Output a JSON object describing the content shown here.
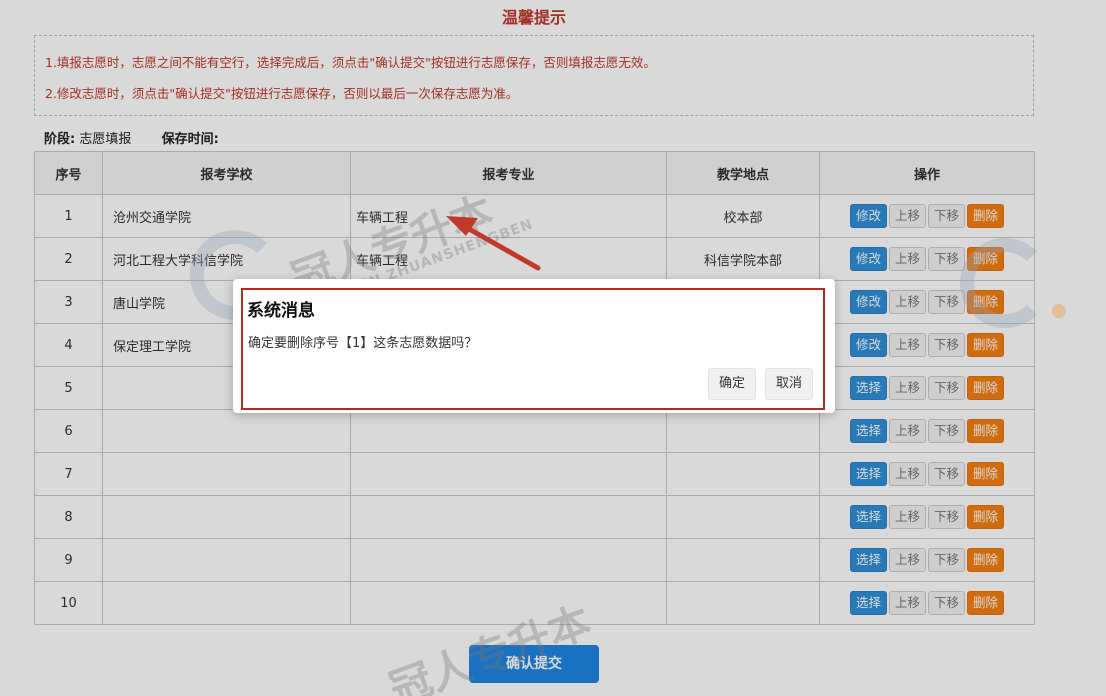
{
  "notice": {
    "title": "温馨提示",
    "line1": "1.填报志愿时，志愿之间不能有空行，选择完成后，须点击\"确认提交\"按钮进行志愿保存，否则填报志愿无效。",
    "line2": "2.修改志愿时，须点击\"确认提交\"按钮进行志愿保存，否则以最后一次保存志愿为准。"
  },
  "stage": {
    "label": "阶段:",
    "value": "志愿填报",
    "save_label": "保存时间:"
  },
  "table": {
    "headers": [
      "序号",
      "报考学校",
      "报考专业",
      "教学地点",
      "操作"
    ],
    "rows": [
      {
        "idx": "1",
        "school": "沧州交通学院",
        "major": "车辆工程",
        "location": "校本部",
        "action": "修改"
      },
      {
        "idx": "2",
        "school": "河北工程大学科信学院",
        "major": "车辆工程",
        "location": "科信学院本部",
        "action": "修改"
      },
      {
        "idx": "3",
        "school": "唐山学院",
        "major": "",
        "location": "",
        "action": "修改"
      },
      {
        "idx": "4",
        "school": "保定理工学院",
        "major": "",
        "location": "",
        "action": "修改"
      },
      {
        "idx": "5",
        "school": "",
        "major": "",
        "location": "",
        "action": "选择"
      },
      {
        "idx": "6",
        "school": "",
        "major": "",
        "location": "",
        "action": "选择"
      },
      {
        "idx": "7",
        "school": "",
        "major": "",
        "location": "",
        "action": "选择"
      },
      {
        "idx": "8",
        "school": "",
        "major": "",
        "location": "",
        "action": "选择"
      },
      {
        "idx": "9",
        "school": "",
        "major": "",
        "location": "",
        "action": "选择"
      },
      {
        "idx": "10",
        "school": "",
        "major": "",
        "location": "",
        "action": "选择"
      }
    ],
    "up_label": "上移",
    "down_label": "下移",
    "delete_label": "删除"
  },
  "submit_label": "确认提交",
  "dialog": {
    "title": "系统消息",
    "message": "确定要删除序号【1】这条志愿数据吗？",
    "ok_label": "确定",
    "cancel_label": "取消"
  },
  "watermark": {
    "brand": "冠人专升本",
    "pinyin": "GUANREN ZHUANSHENGBEN"
  },
  "colors": {
    "notice_red": "#c0392b",
    "primary_blue": "#2f8fd8",
    "delete_orange": "#f47f12",
    "dialog_border": "#b32b1f",
    "arrow_red": "#c0392b"
  }
}
